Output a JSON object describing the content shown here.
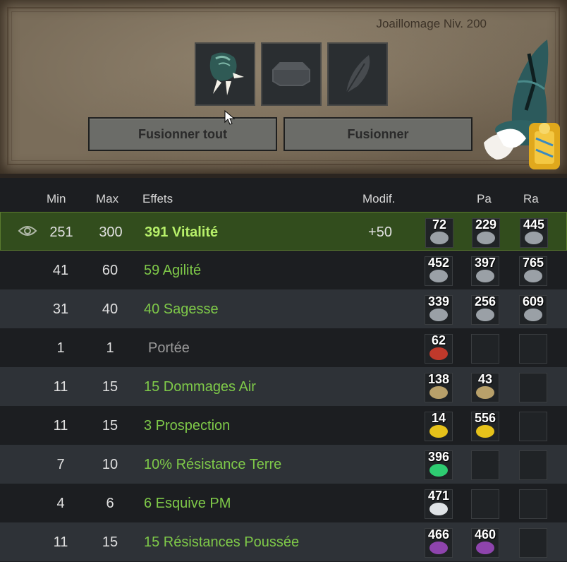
{
  "header": {
    "job_title": "Joaillomage Niv. 200",
    "btn_fuse_all": "Fusionner tout",
    "btn_fuse": "Fusionner"
  },
  "slots": [
    {
      "name": "item-slot",
      "icon": "claw-glove-icon"
    },
    {
      "name": "rune-slot",
      "icon": "octagon-rune-icon"
    },
    {
      "name": "potion-slot",
      "icon": "feather-icon"
    }
  ],
  "columns": {
    "min": "Min",
    "max": "Max",
    "effects": "Effets",
    "modif": "Modif.",
    "pa": "Pa",
    "ra": "Ra"
  },
  "rows": [
    {
      "min": "251",
      "max": "300",
      "effect": "391 Vitalité",
      "modif": "+50",
      "runes": [
        "72",
        "229",
        "445"
      ],
      "gem_color": "#9aa0a6"
    },
    {
      "min": "41",
      "max": "60",
      "effect": "59 Agilité",
      "modif": "",
      "runes": [
        "452",
        "397",
        "765"
      ],
      "gem_color": "#9aa0a6"
    },
    {
      "min": "31",
      "max": "40",
      "effect": "40 Sagesse",
      "modif": "",
      "runes": [
        "339",
        "256",
        "609"
      ],
      "gem_color": "#9aa0a6"
    },
    {
      "min": "1",
      "max": "1",
      "effect": "Portée",
      "modif": "",
      "runes": [
        "62",
        "",
        ""
      ],
      "gem_color": "#c0392b"
    },
    {
      "min": "11",
      "max": "15",
      "effect": "15 Dommages Air",
      "modif": "",
      "runes": [
        "138",
        "43",
        ""
      ],
      "gem_color": "#b8a06a"
    },
    {
      "min": "11",
      "max": "15",
      "effect": "3 Prospection",
      "modif": "",
      "runes": [
        "14",
        "556",
        ""
      ],
      "gem_color": "#e6c21a"
    },
    {
      "min": "7",
      "max": "10",
      "effect": "10% Résistance Terre",
      "modif": "",
      "runes": [
        "396",
        "",
        ""
      ],
      "gem_color": "#2ecc71"
    },
    {
      "min": "4",
      "max": "6",
      "effect": "6 Esquive PM",
      "modif": "",
      "runes": [
        "471",
        "",
        ""
      ],
      "gem_color": "#dfe3e6"
    },
    {
      "min": "11",
      "max": "15",
      "effect": "15 Résistances Poussée",
      "modif": "",
      "runes": [
        "466",
        "460",
        ""
      ],
      "gem_color": "#8e44ad"
    }
  ]
}
